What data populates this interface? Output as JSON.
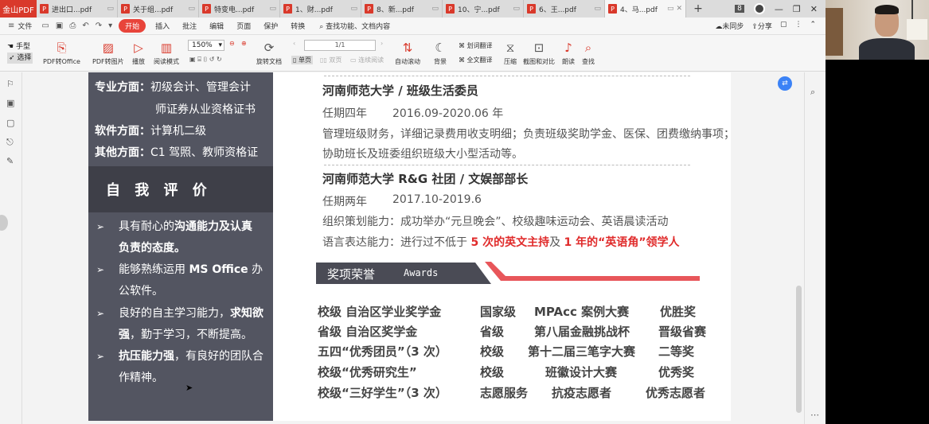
{
  "app": {
    "logo": "金山PDF",
    "tabs": [
      {
        "label": "进出口...pdf",
        "active": false
      },
      {
        "label": "关于组...pdf",
        "active": false
      },
      {
        "label": "特变电...pdf",
        "active": false
      },
      {
        "label": "1、财...pdf",
        "active": false
      },
      {
        "label": "8、新...pdf",
        "active": false
      },
      {
        "label": "10、宁...pdf",
        "active": false
      },
      {
        "label": "6、王...pdf",
        "active": false
      },
      {
        "label": "4、马...pdf",
        "active": true
      }
    ],
    "new_tab": "+",
    "window_badge": "8"
  },
  "menubar": {
    "file": "文件",
    "start": "开始",
    "items": [
      "插入",
      "批注",
      "编辑",
      "页面",
      "保护",
      "转换"
    ],
    "search": "查找功能、文档内容",
    "sync": "未同步",
    "share": "分享"
  },
  "toolbar": {
    "hand": "手型",
    "select": "选择",
    "pdf_to_office": "PDF转Office",
    "pdf_to_image": "PDF转图片",
    "play": "播放",
    "read_mode": "阅读模式",
    "zoom": "150%",
    "rotate": "旋转文档",
    "page_input": "1/1",
    "single": "单页",
    "double": "双页",
    "continuous": "连续阅读",
    "auto_scroll": "自动滚动",
    "background": "背景",
    "translate_word": "划词翻译",
    "translate_full": "全文翻译",
    "compress": "压缩",
    "screenshot": "截图和对比",
    "read_aloud": "朗读",
    "find": "查找"
  },
  "resume": {
    "left": {
      "skills": [
        {
          "label": "专业方面：",
          "value": "初级会计、管理会计"
        },
        {
          "label": "",
          "value": "师证券从业资格证书"
        },
        {
          "label": "软件方面：",
          "value": "计算机二级"
        },
        {
          "label": "其他方面：",
          "value": "C1 驾照、教师资格证"
        }
      ],
      "eval_title": "自 我 评 价",
      "evaluations": [
        {
          "arrow": "➢",
          "l1a": "具有耐心的",
          "l1b": "沟通能力及认真",
          "l2a": "负责的态度。",
          "l2b": ""
        },
        {
          "arrow": "➢",
          "l1a": "能够熟练运用 ",
          "l1b": "MS Office",
          "l1c": " 办",
          "l2a": "公软件。",
          "l2b": ""
        },
        {
          "arrow": "➢",
          "l1a": "良好的自主学习能力，",
          "l1b": "求知欲",
          "l2a": "强",
          "l2b": "，勤于学习，不断提高。"
        },
        {
          "arrow": "➢",
          "l1a": "抗压能力强",
          "l1b": "，有良好的团队合",
          "l2a": "作精神。",
          "l2b": ""
        }
      ]
    },
    "right": {
      "exp1": {
        "title": "河南师范大学 / 班级生活委员",
        "period_label": "任期四年",
        "period": "2016.09-2020.06 年",
        "line1": "管理班级财务，详细记录费用收支明细；负责班级奖助学金、医保、团费缴纳事项；",
        "line2": "协助班长及班委组织班级大小型活动等。"
      },
      "exp2": {
        "title": "河南师范大学 R&G 社团 / 文娱部部长",
        "period_label": "任期两年",
        "period": "2017.10-2019.6",
        "line1": "组织策划能力：成功举办“元旦晚会”、校级趣味运动会、英语晨读活动",
        "line2a": "语言表达能力：进行过不低于 ",
        "line2b": "5 次的英文主持",
        "line2c": "及 ",
        "line2d": "1 年的“英语角”领学人"
      },
      "awards_cn": "奖项荣誉",
      "awards_en": "Awards",
      "awards": [
        [
          "校级 自治区学业奖学金",
          "国家级",
          "MPAcc 案例大赛",
          "优胜奖"
        ],
        [
          "省级 自治区奖学金",
          "省级",
          "第八届金融挑战杯",
          "晋级省赛"
        ],
        [
          "五四“优秀团员”（3 次）",
          "校级",
          "第十二届三笔字大赛",
          "二等奖"
        ],
        [
          "校级“优秀研究生”",
          "校级",
          "班徽设计大赛",
          "优秀奖"
        ],
        [
          "校级“三好学生”（3 次）",
          "志愿服务",
          "抗疫志愿者",
          "优秀志愿者"
        ]
      ]
    }
  },
  "colors": {
    "accent": "#e8443a",
    "sidebar": "#535561",
    "highlight": "#e02b2b"
  }
}
